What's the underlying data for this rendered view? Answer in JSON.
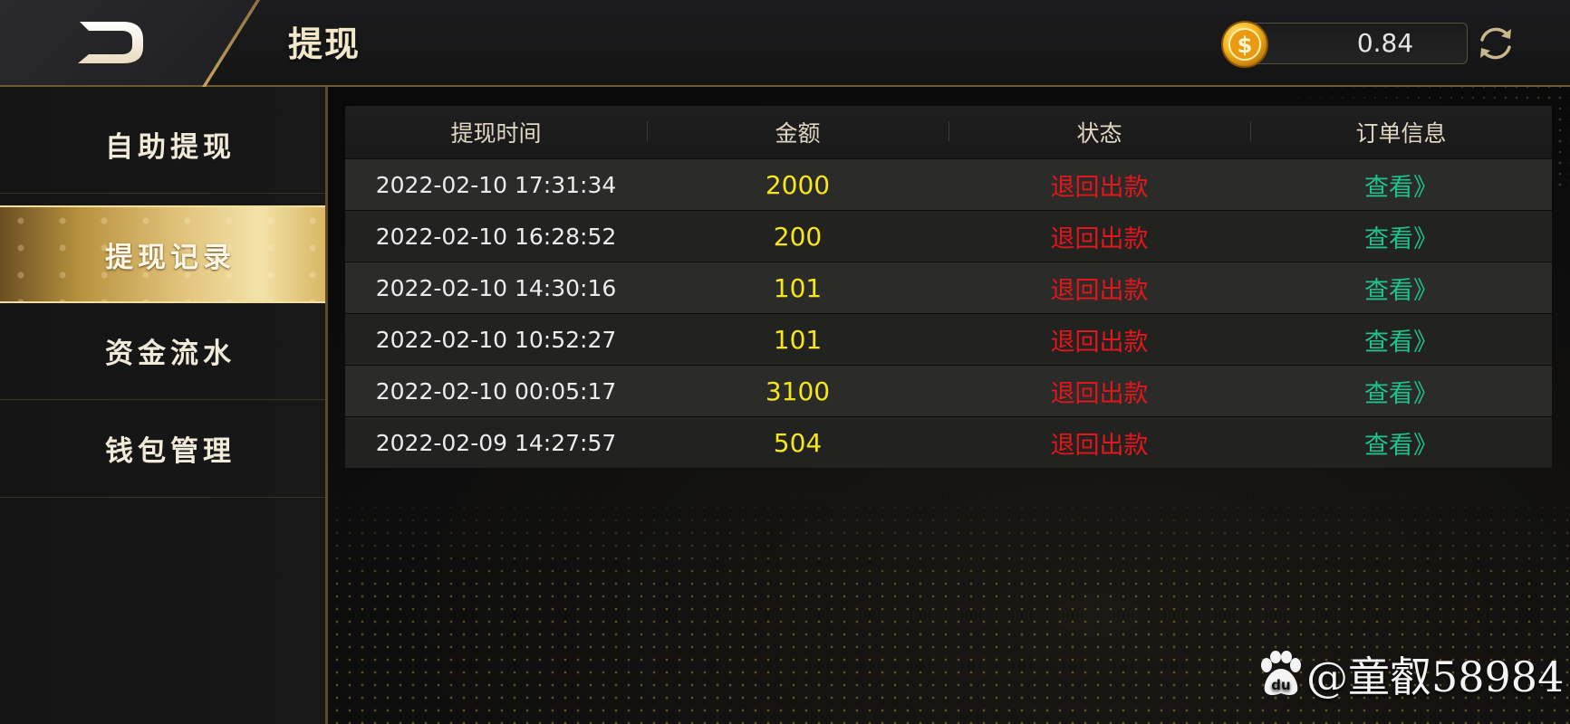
{
  "header": {
    "title": "提现",
    "balance": "0.84",
    "coin_symbol": "$"
  },
  "sidebar": {
    "items": [
      {
        "label": "自助提现",
        "active": false
      },
      {
        "label": "提现记录",
        "active": true
      },
      {
        "label": "资金流水",
        "active": false
      },
      {
        "label": "钱包管理",
        "active": false
      }
    ]
  },
  "table": {
    "columns": [
      "提现时间",
      "金额",
      "状态",
      "订单信息"
    ],
    "rows": [
      {
        "time": "2022-02-10 17:31:34",
        "amount": "2000",
        "status": "退回出款",
        "detail": "查看》"
      },
      {
        "time": "2022-02-10 16:28:52",
        "amount": "200",
        "status": "退回出款",
        "detail": "查看》"
      },
      {
        "time": "2022-02-10 14:30:16",
        "amount": "101",
        "status": "退回出款",
        "detail": "查看》"
      },
      {
        "time": "2022-02-10 10:52:27",
        "amount": "101",
        "status": "退回出款",
        "detail": "查看》"
      },
      {
        "time": "2022-02-10 00:05:17",
        "amount": "3100",
        "status": "退回出款",
        "detail": "查看》"
      },
      {
        "time": "2022-02-09 14:27:57",
        "amount": "504",
        "status": "退回出款",
        "detail": "查看》"
      }
    ]
  },
  "watermark": {
    "badge": "du",
    "text": "@童叡58984"
  },
  "colors": {
    "accent_gold": "#d9b765",
    "amount_yellow": "#f5e61e",
    "status_red": "#e3171b",
    "link_green": "#1fc28a"
  },
  "icons": {
    "back": "back-arrow-icon",
    "coin": "gold-coin-icon",
    "refresh": "refresh-icon",
    "watermark": "baidu-paw-icon"
  }
}
